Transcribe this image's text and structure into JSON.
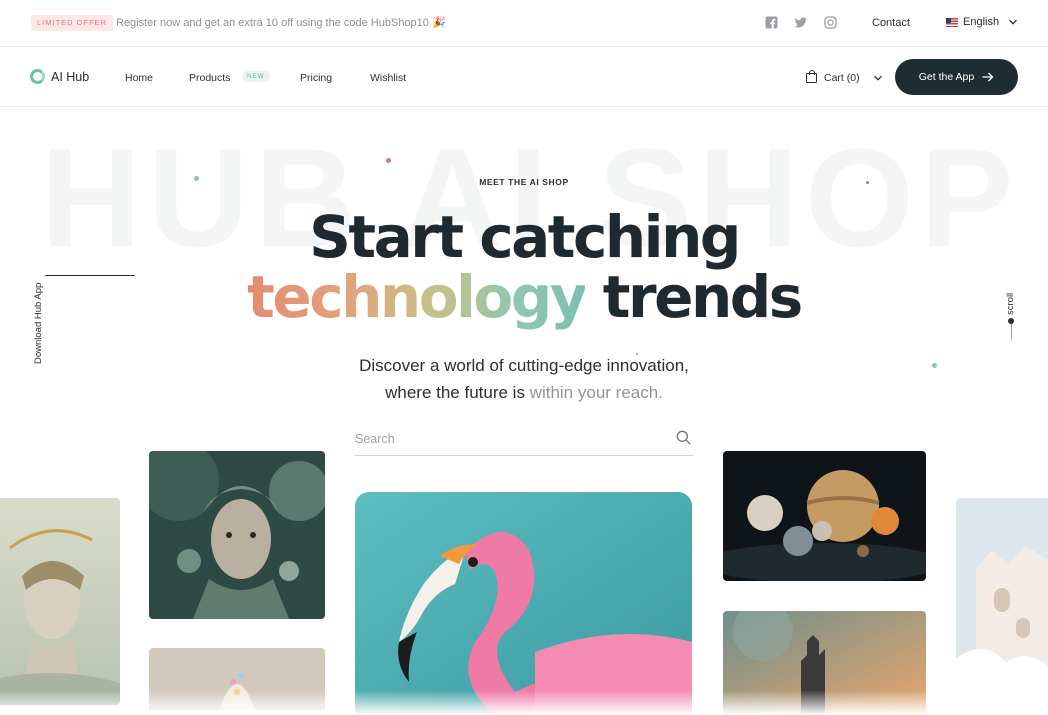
{
  "announcement": {
    "badge": "LIMITED OFFER",
    "message": "Register now and get an extra 10 off using the code HubShop10 🎉",
    "social_icons": [
      "facebook-icon",
      "twitter-icon",
      "instagram-icon"
    ],
    "contact_label": "Contact",
    "language_label": "English"
  },
  "header": {
    "logo_text": "AI Hub",
    "nav": [
      {
        "label": "Home"
      },
      {
        "label": "Products",
        "badge": "NEW"
      },
      {
        "label": "Pricing"
      },
      {
        "label": "Wishlist"
      }
    ],
    "cart_label": "Cart (0)",
    "cta_label": "Get the App"
  },
  "hero": {
    "watermark": "HUB AI SHOP",
    "eyebrow": "MEET THE AI SHOP",
    "headline_line1": "Start catching",
    "headline_gradient": "technology",
    "headline_rest": " trends",
    "sub_line1": "Discover a world of cutting-edge innovation,",
    "sub_line2_plain": "where the future is ",
    "sub_line2_muted": "within your reach.",
    "search_placeholder": "Search",
    "side_download": "Download Hub App",
    "side_scroll": "scroll"
  },
  "gallery": [
    {
      "subject": "classical bust statue with leaf crown"
    },
    {
      "subject": "woman face covered with coral"
    },
    {
      "subject": "ice cream sundae"
    },
    {
      "subject": "pink flamingo"
    },
    {
      "subject": "planets in space"
    },
    {
      "subject": "castle at sunset"
    },
    {
      "subject": "white fantasy castle sculpture"
    }
  ],
  "colors": {
    "accent_dark": "#1e2c33",
    "offer_badge_bg": "#fde7e7",
    "offer_badge_text": "#e0747a",
    "gradient": [
      "#e58a72",
      "#c7c189",
      "#7bbfb0"
    ]
  }
}
